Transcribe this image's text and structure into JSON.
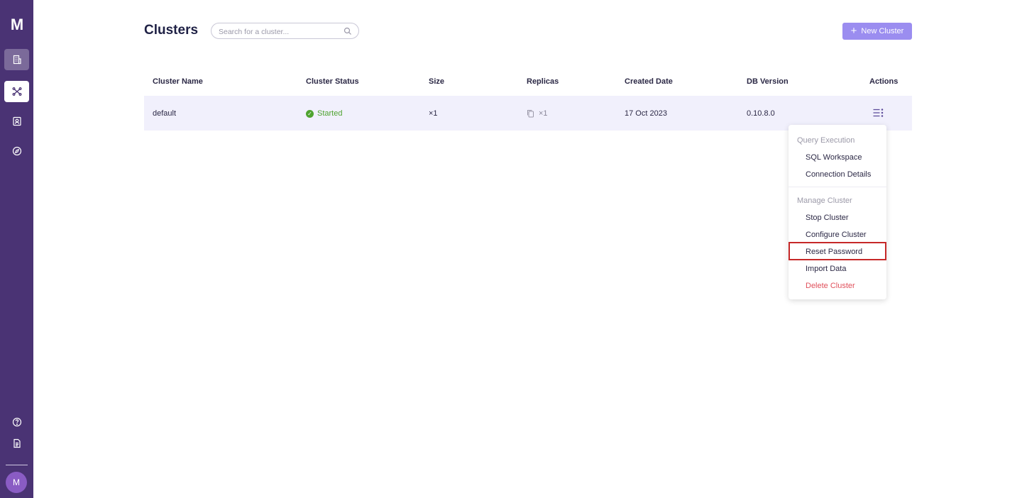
{
  "sidebar": {
    "logo": "M",
    "items": [
      {
        "name": "clusters-nav",
        "icon": "building-icon"
      },
      {
        "name": "topology-nav",
        "icon": "network-icon"
      },
      {
        "name": "contacts-nav",
        "icon": "contact-book-icon"
      },
      {
        "name": "explore-nav",
        "icon": "compass-icon"
      }
    ],
    "footer": [
      {
        "name": "help-nav",
        "icon": "help-circle-icon"
      },
      {
        "name": "docs-nav",
        "icon": "document-icon"
      }
    ],
    "avatar_initial": "M"
  },
  "header": {
    "title": "Clusters",
    "search_placeholder": "Search for a cluster...",
    "new_cluster_label": "New Cluster"
  },
  "table": {
    "columns": [
      "Cluster Name",
      "Cluster Status",
      "Size",
      "Replicas",
      "Created Date",
      "DB Version",
      "Actions"
    ],
    "rows": [
      {
        "name": "default",
        "status": "Started",
        "size": "×1",
        "replicas": "×1",
        "created": "17 Oct 2023",
        "version": "0.10.8.0"
      }
    ]
  },
  "actions_menu": {
    "groups": [
      {
        "label": "Query Execution",
        "items": [
          "SQL Workspace",
          "Connection Details"
        ]
      },
      {
        "label": "Manage Cluster",
        "items": [
          "Stop Cluster",
          "Configure Cluster",
          "Reset Password",
          "Import Data",
          "Delete Cluster"
        ]
      }
    ],
    "highlighted": "Reset Password"
  },
  "colors": {
    "sidebar": "#4a3374",
    "accent": "#9b8df0",
    "status_ok": "#4fa330",
    "danger": "#e0505b",
    "highlight_border": "#c62828"
  }
}
